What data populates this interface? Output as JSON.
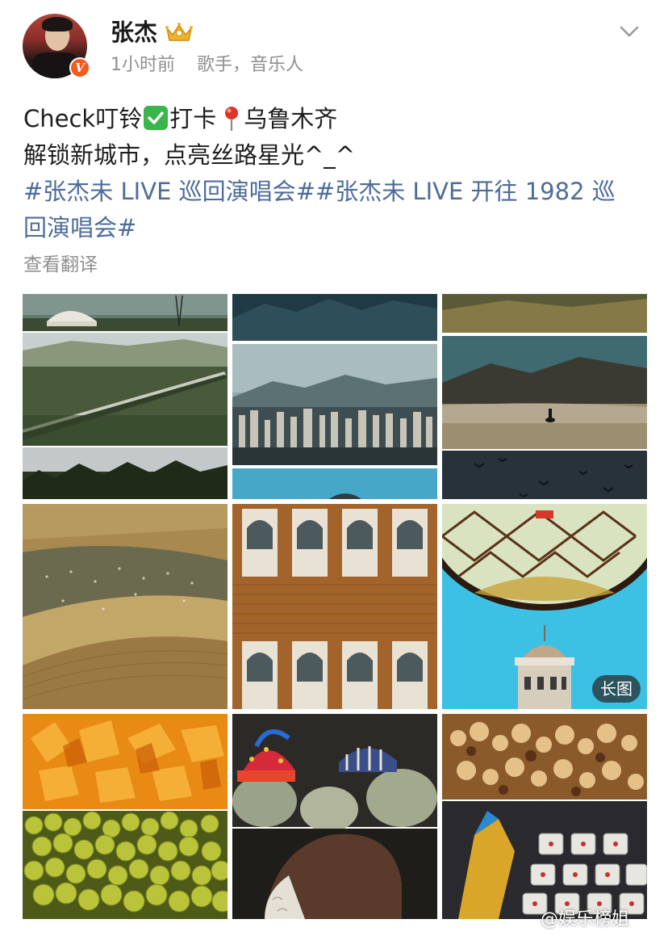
{
  "post": {
    "author": {
      "name": "张杰",
      "verified_mark": "V",
      "time": "1小时前",
      "description": "歌手，音乐人"
    },
    "text": {
      "line1_part1": "Check叮铃",
      "line1_part2": "打卡",
      "line1_part3": "乌鲁木齐",
      "line2": "解锁新城市，点亮丝路星光^_^",
      "hashtag1": "#张杰未 LIVE 巡回演唱会#",
      "hashtag2": "#张杰未 LIVE 开往 1982 巡回演唱会#"
    },
    "translate_label": "查看翻译",
    "images": {
      "long_image_badge": "长图"
    },
    "watermark": "@娱乐榜姐"
  },
  "colors": {
    "hashtag": "#4e6c9a",
    "meta": "#8f8f8f",
    "verified_badge": "#f25a1f",
    "check_emoji": "#3ab54a"
  },
  "icons": {
    "crown": "crown-icon",
    "chevron": "chevron-down-icon",
    "check": "check-mark-icon",
    "pin": "location-pin-icon"
  }
}
